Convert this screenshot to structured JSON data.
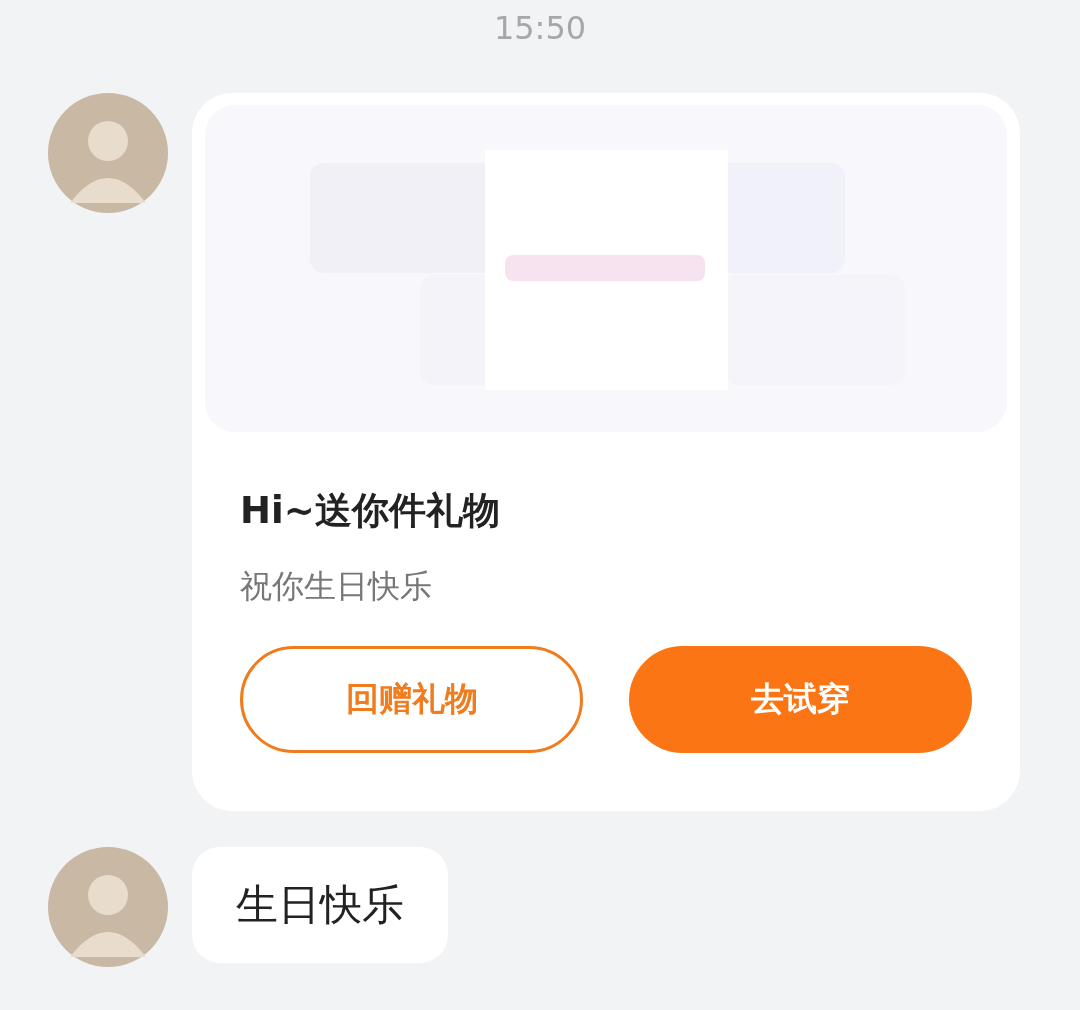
{
  "timestamp": "15:50",
  "messages": [
    {
      "kind": "gift_card",
      "title": "Hi~送你件礼物",
      "subtitle": "祝你生日快乐",
      "buttons": [
        {
          "label": "回赠礼物",
          "kind": "outline"
        },
        {
          "label": "去试穿",
          "kind": "filled"
        }
      ]
    },
    {
      "kind": "text",
      "text": "生日快乐"
    }
  ]
}
